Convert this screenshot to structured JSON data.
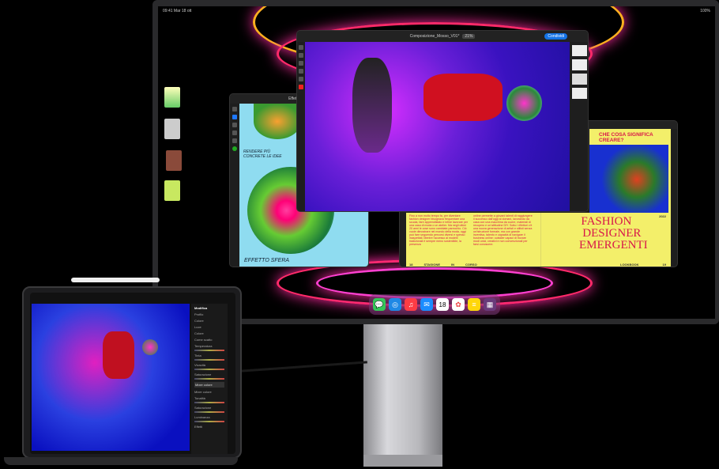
{
  "status_bar": {
    "time": "09:41 Mar 18 ott",
    "battery": "100%"
  },
  "photoshop": {
    "document_title": "Composizione_Mosso_V01*",
    "zoom": "21%",
    "share_label": "Condividi"
  },
  "fresco": {
    "document_title": "Effetto sfera",
    "caption_top": "RENDERE PIÙ CONCRETE LE IDEE",
    "caption_bottom": "EFFETTO SFERA"
  },
  "magazine": {
    "cover_title": "CHE COSA SIGNIFICA CREARE?",
    "body_col1": "Fino a non molto tempo fa, per diventare fashion designer bisognava frequentare una scuola, fare apprendistato e infine lavorare per una casa di moda o un atelier. Ma negli ultimi 20 anni le cose sono cambiate parecchio. Ciò vuole dimostrare nel mondo della moda, oggi può fare seguendo percorsi diversi e spesso inaspettati. Mentre l'accesso ai modelli tradizionali è sempre meno sostenibile, la presenza",
    "body_col2": "online permette a giovani talenti di raggiungere il successo dall'oggi al domani, lavorando da casa con una macchina da cucire, materiali di recupero e un'attitudine DIY. Sotto i riflettori c'è una nuova generazione di artisti e stilisti senza un'istruzione formale, ma con grande inventiva, talento e capacità di navigare il business online: outsider capaci di trovare modi unici, creativi e non convenzionali per farsi conoscere.",
    "footer_left": [
      "18",
      "STAGIONE",
      "IN",
      "CORSO"
    ],
    "headline": [
      "FASHION",
      "DESIGNER",
      "EMERGENTI"
    ],
    "year": "2022",
    "footer_right": "LOOKBOOK",
    "page_right": "19"
  },
  "dock": {
    "apps": [
      {
        "name": "Messages",
        "icon": "messages-icon",
        "color": "#34c759",
        "glyph": "💬"
      },
      {
        "name": "Safari",
        "icon": "safari-icon",
        "color": "#1e88e5",
        "glyph": "🧭"
      },
      {
        "name": "Music",
        "icon": "music-icon",
        "color": "#fc3c44",
        "glyph": "♫"
      },
      {
        "name": "Mail",
        "icon": "mail-icon",
        "color": "#1a8cff",
        "glyph": "✉"
      },
      {
        "name": "Calendar",
        "icon": "calendar-icon",
        "color": "#ffffff",
        "glyph": "18"
      },
      {
        "name": "Photos",
        "icon": "photos-icon",
        "color": "#ffffff",
        "glyph": "✿"
      },
      {
        "name": "Notes",
        "icon": "notes-icon",
        "color": "#ffd60a",
        "glyph": "≡"
      },
      {
        "name": "App Library",
        "icon": "app-library-icon",
        "color": "#6a3a7a",
        "glyph": "▦"
      }
    ]
  },
  "ipad_lightroom": {
    "panel_title": "Modifica",
    "profile_label": "Profilo",
    "profile_value": "Colore",
    "sections": [
      "Luce",
      "Colore"
    ],
    "auto_label": "Bianco",
    "wb_label": "Come scatto",
    "sliders": [
      {
        "label": "Temperatura",
        "value": 0.5
      },
      {
        "label": "Tinta",
        "value": 0.45
      },
      {
        "label": "Vivacità",
        "value": 0.55
      },
      {
        "label": "Saturazione",
        "value": 0.5
      }
    ],
    "mixer_button": "Mixer colore",
    "mixer_label": "Mixer colore",
    "mixer_sliders": [
      {
        "label": "Tonalità",
        "value": 0.68
      },
      {
        "label": "Saturazione",
        "value": 0.5
      },
      {
        "label": "Luminanza",
        "value": 0.45
      }
    ],
    "effects_label": "Effetti"
  }
}
